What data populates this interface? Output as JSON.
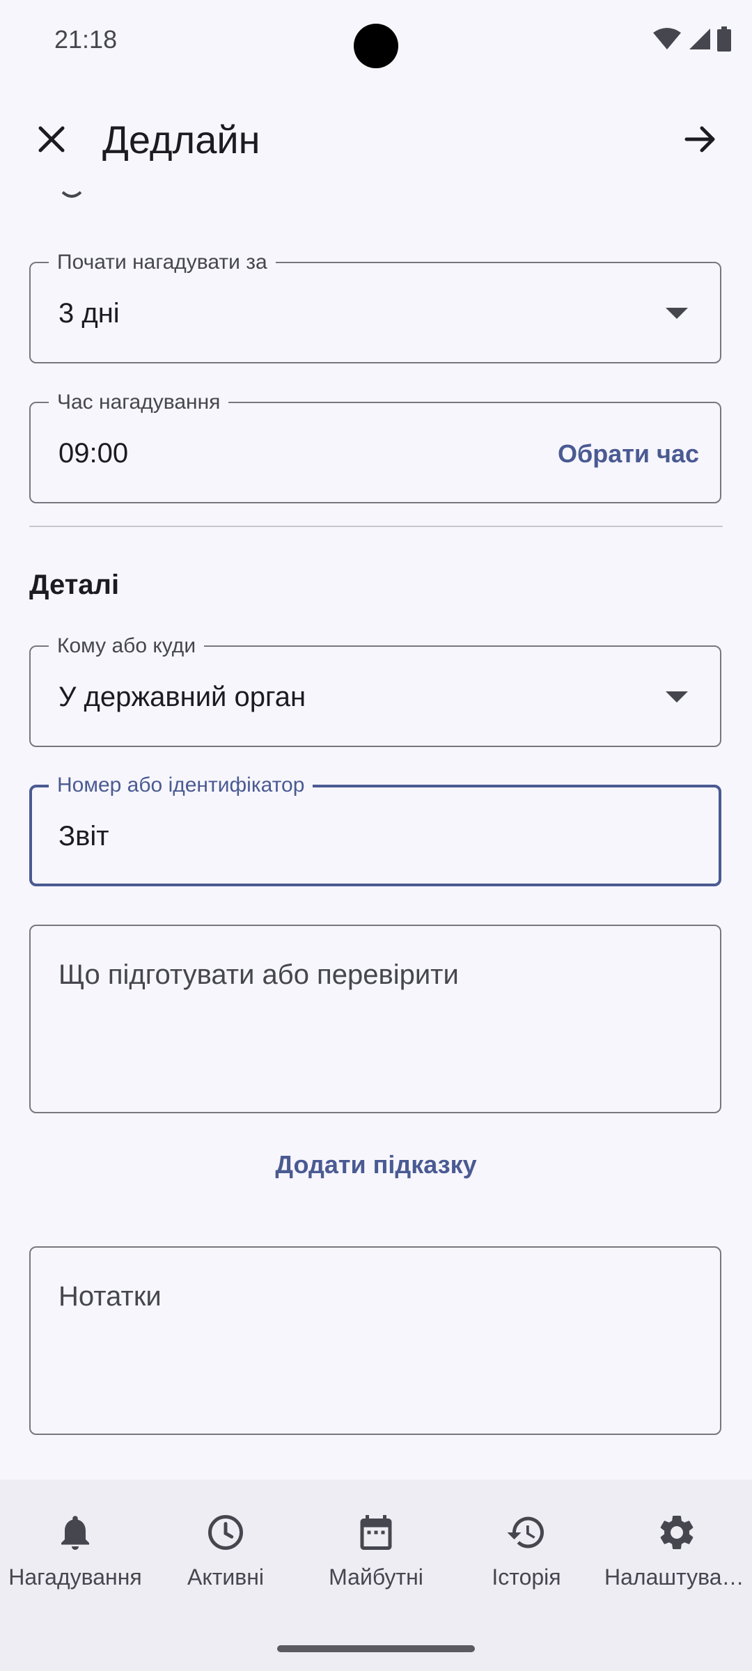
{
  "status": {
    "time": "21:18"
  },
  "toolbar": {
    "title": "Дедлайн"
  },
  "reminder": {
    "start_label": "Почати нагадувати за",
    "start_value": "3 дні",
    "time_label": "Час нагадування",
    "time_value": "09:00",
    "pick_time": "Обрати час"
  },
  "details": {
    "section_title": "Деталі",
    "recipient_label": "Кому або куди",
    "recipient_value": "У державний орган",
    "id_label": "Номер або ідентифікатор",
    "id_value": "Звіт",
    "prepare_placeholder": "Що підготувати або перевірити",
    "add_hint": "Додати підказку",
    "notes_placeholder": "Нотатки"
  },
  "nav": {
    "items": [
      {
        "label": "Нагадування",
        "icon": "bell-icon"
      },
      {
        "label": "Активні",
        "icon": "clock-icon"
      },
      {
        "label": "Майбутні",
        "icon": "calendar-icon"
      },
      {
        "label": "Історія",
        "icon": "history-icon"
      },
      {
        "label": "Налаштування",
        "icon": "gear-icon"
      }
    ]
  }
}
